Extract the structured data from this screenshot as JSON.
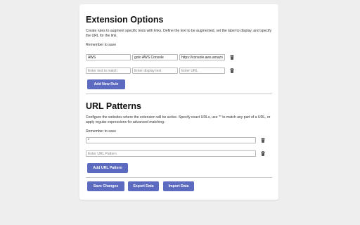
{
  "extension_options": {
    "title": "Extension Options",
    "description": "Create rules to augment specific texts with links. Define the text to be augmented, set the label to display, and specify the URL for the link.",
    "reminder": "Remember to save",
    "rules": [
      {
        "text": "AWS",
        "label": "goto AWS Console",
        "url": "https://console.aws.amazon.com"
      }
    ],
    "new_rule": {
      "text_placeholder": "Enter text to match",
      "label_placeholder": "Enter display text",
      "url_placeholder": "Enter URL"
    },
    "add_rule_label": "Add New Rule"
  },
  "url_patterns": {
    "title": "URL Patterns",
    "description": "Configure the websites where the extension will be active. Specify exact URLs, use '*' to match any part of a URL, or apply regular expressions for advanced matching.",
    "reminder": "Remember to save",
    "patterns": [
      "*"
    ],
    "new_pattern_placeholder": "Enter URL Pattern",
    "add_pattern_label": "Add URL Pattern"
  },
  "footer": {
    "save_label": "Save Changes",
    "export_label": "Export Data",
    "import_label": "Import Data"
  },
  "icons": {
    "delete": "trash-icon"
  },
  "colors": {
    "accent": "#5c6bc0",
    "background": "#eeeeee",
    "card": "#ffffff"
  }
}
